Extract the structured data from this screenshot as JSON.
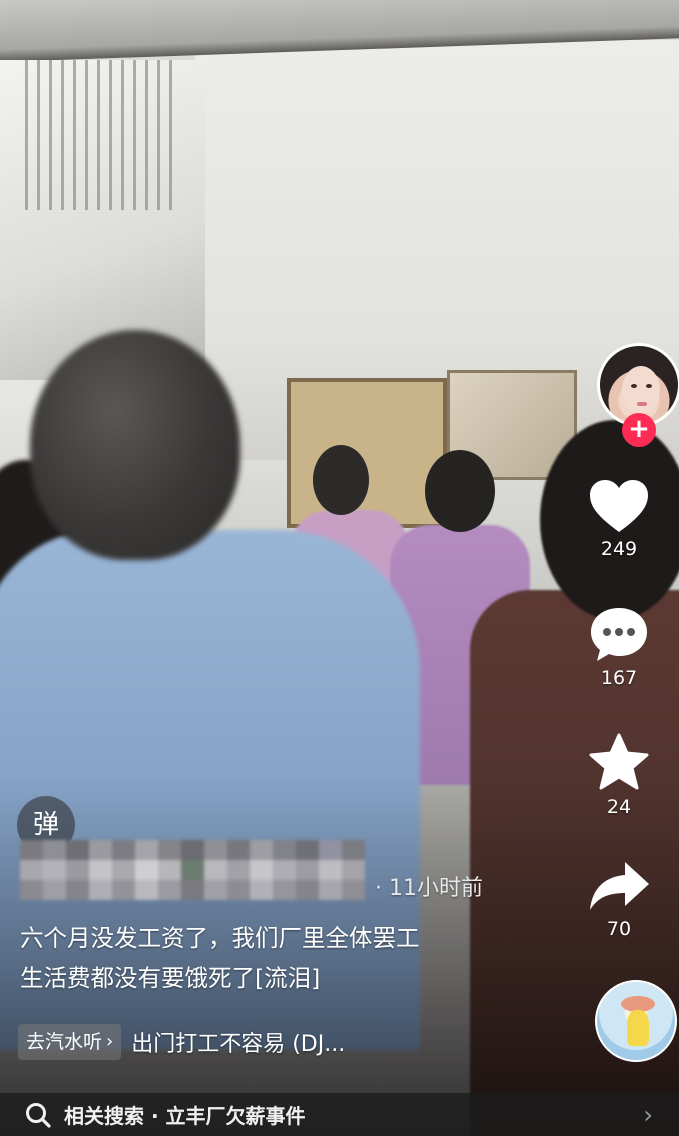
{
  "video": {
    "author_avatar_icon": "author-avatar",
    "follow_icon": "plus-icon"
  },
  "actions": {
    "like_count": "249",
    "comment_count": "167",
    "favorite_count": "24",
    "share_count": "70"
  },
  "danmu_label": "弹",
  "post": {
    "time_ago": "· 11小时前",
    "caption_line1": "六个月没发工资了，我们厂里全体罢工",
    "caption_line2": "生活费都没有要饿死了[流泪]"
  },
  "music": {
    "tag_label": "去汽水听",
    "tag_chevron": "›",
    "title": "出门打工不容易 (DJ..."
  },
  "related_search": {
    "label": "相关搜索 · 立丰厂欠薪事件",
    "arrow": "›"
  },
  "colors": {
    "follow_red": "#fe2c55",
    "icon_white": "#ffffff",
    "search_bar_bg": "#1c1c1c"
  }
}
